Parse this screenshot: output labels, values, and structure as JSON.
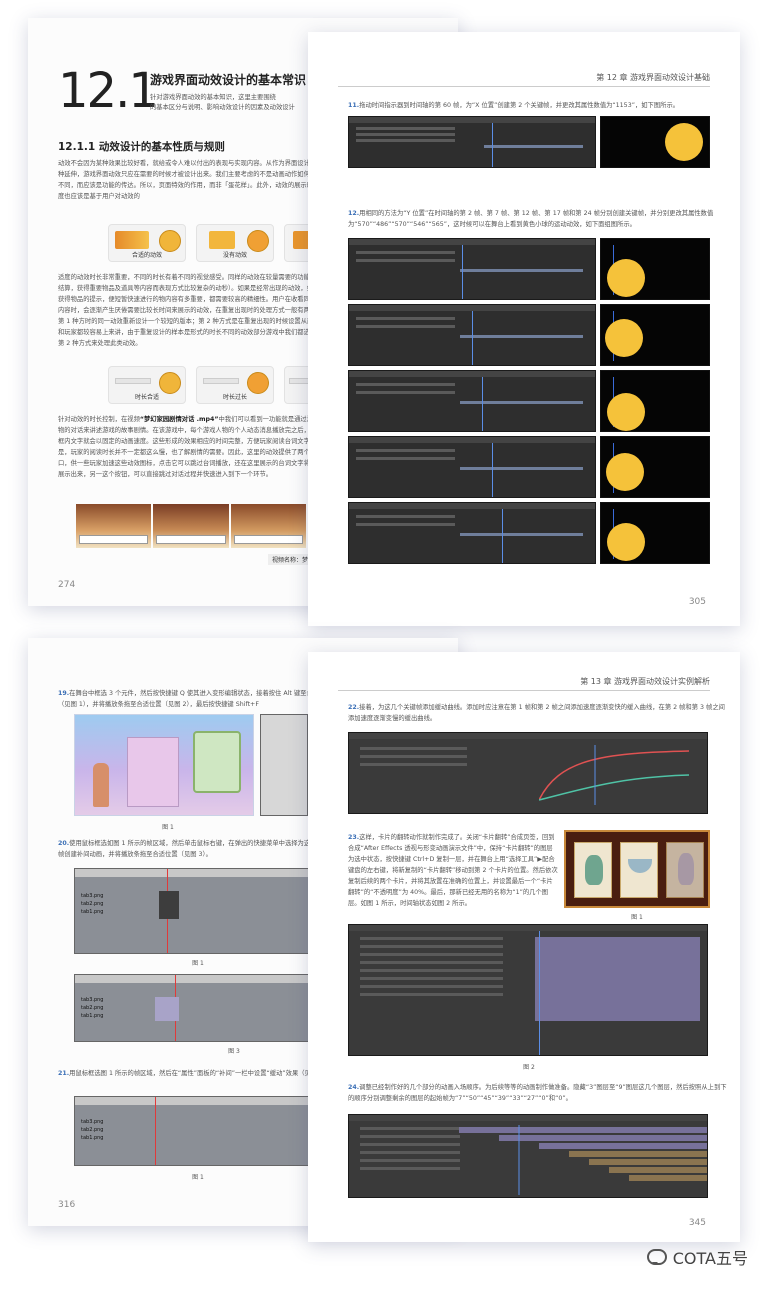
{
  "page1": {
    "chapter_number": "12.1",
    "chapter_title": "游戏界面动效设计的基本常识",
    "chapter_intro_1": "针对游戏界面动效的基本知识，这里主要围绕",
    "chapter_intro_2": "的基本区分与说明、影响动效设计的因素及动效设计",
    "section_title": "12.1.1  动效设计的基本性质与规则",
    "para_1": "动效不会因为某种效果比较好看，就给或令人难以付出的表现与实现内容。从作为界面设计的一种延伸，游戏界面动效只应在需要的时候才被设计出来。我们主要考虑的不是动画动作如何与众不同，而应该是功能的传达。所以，页面特效的作用，而非「蛋花样」。此外，动效的展示时间长度也应该是基于用户对动效的",
    "chip_1_label": "合适的动效",
    "chip_2_label": "没有动效",
    "para_2": "适度的动效时长非常重要，不同的时长有着不同的视觉感受。同样的动效在较量需要的功能，如结算，获得重要物品及道具等内容而表现方式比较复杂的动秒）。如果是经常出现的动效，如频繁获得物品的提示，便短暂快速进行的物内容有多重要，都需要较高的精细性。用户在收看同样的内容时，会逐渐产生厌倦需要比较长时间来展示的动效，在重复出现时的处理方式一般有两种：第 1 种方时的同一动效重新设计一个较短的版本；第 2 种方式是在重复出现的时候设置从而游戏和玩家都较容易上来讲，由于重复设计的样本是形式的时长不同的动效部分游戏中我们都选择用第 2 种方式来处理此类动效。",
    "chip_3_label": "时长合适",
    "chip_4_label": "时长过长",
    "para_3_pre": "针对动效的时长控制，在视频",
    "para_3_bold": "“梦幻家园剧情对话 .mp4”",
    "para_3_post": "中我们可以看到一功能就是通过游戏人物的对话来讲述游戏的故事剧情。在该游戏中，每个游戏人物的个人动态消息播放完之后，台词框内文字就会以固定的动画速度。这些形成的效果相应的时间完整，方便玩家阅读台词文字。但是，玩家的阅读时长并不一定都这么慢，也了解剧情的需要。因此，这里的动效提供了两个入口，供一些玩家加速这些动效图标，点击它可以跳过台词播放，还在这里展示的台词文字将瞬间展示出来，另一这个按钮，可以直接跳过对话过程并快速进入到下一个环节。",
    "video_caption": "视频名称：梦",
    "page_number": "274"
  },
  "page2": {
    "running_head": "第 12 章  游戏界面动效设计基础",
    "step_11_num": "11.",
    "step_11": "拖动时间指示器到时间轴的第 60 帧，为“X 位置”创建第 2 个关键帧，并更改其属性数值为“1153”，如下图所示。",
    "step_12_num": "12.",
    "step_12": "用相同的方法为“Y 位置”在时间轴的第 2 帧、第 7 帧、第 12 帧、第 17 帧和第 24 帧分别创建关键帧，并分别更改其属性数值为“570”“486”“570”“546”“565”，这时候可以在舞台上看到黄色小球的运动动效，如下面组图所示。",
    "page_number": "305"
  },
  "page3": {
    "step_19_num": "19.",
    "step_19": "在舞台中框选 3 个元件，然后按快捷键 Q 使其进入变形编辑状态，接着按住 Alt 键至合适位置（见图 1），并将播放条拖至合适位置（见图 2），最后按快捷键 Shift+F",
    "fig1": "图 1",
    "step_20_num": "20.",
    "step_20": "使用鼠标框选如图 1 所示的帧区域，然后单击鼠标右键，在弹出的快捷菜单中选择为这几个关键帧创建补间动画，并将播放条拖至合适位置（见图 3）。",
    "fig1b": "图 1",
    "fig3": "图 3",
    "layer_a": "tab3.png",
    "layer_b": "tab2.png",
    "layer_c": "tab1.png",
    "step_21_num": "21.",
    "step_21": "用鼠标框选图 1 所示的帧区域，然后在“属性”面板的“补间”一栏中设置“缓动”效果（见图 2）。",
    "fig1c": "图 1",
    "page_number": "316"
  },
  "page4": {
    "running_head": "第 13 章  游戏界面动效设计实例解析",
    "step_22_num": "22.",
    "step_22": "接着，为这几个关键帧添加缓动曲线。添加时应注意在第 1 帧和第 2 帧之间添加速度逐渐变快的缓入曲线，在第 2 帧和第 3 帧之间添加速度逐渐变慢的缓出曲线。",
    "step_23_num": "23.",
    "step_23": "这样，卡片的翻转动作就制作完成了。关闭“卡片翻转”合成页签，回到合成“After Effects 透视与形变动画演示文件”中，保持“卡片翻转”的图层为选中状态，按快捷键 Ctrl+D 复制一层，并在舞台上用“选择工具”▶配合键盘的左右键，将新复制的“卡片翻转”移动到第 2 个卡片的位置。然后依次复制后续的两个卡片，并将其放置在准确的位置上，并设置最后一个“卡片翻转”的“不透明度”为 40%。最后，那新已经无用的名称为“1”的几个图层。如图 1 所示，时间轴状态如图 2 所示。",
    "fig1": "图 1",
    "fig2": "图 2",
    "step_24_num": "24.",
    "step_24": "调整已经制作好的几个部分的动画入场顺序。为后续等等的动画制作做准备。隐藏“3”图层至“9”图层这几个图层，然后按照从上到下的顺序分别调整剩余的图层的起始帧为“7”“50”“45”“39”“33”“27”“0”和“0”。",
    "page_number": "345"
  },
  "watermark": {
    "label": "COTA五号"
  },
  "colors": {
    "accent_blue": "#3b6fb6",
    "ball_yellow": "#f5c23a",
    "panel_dark": "#2e2e2e"
  }
}
